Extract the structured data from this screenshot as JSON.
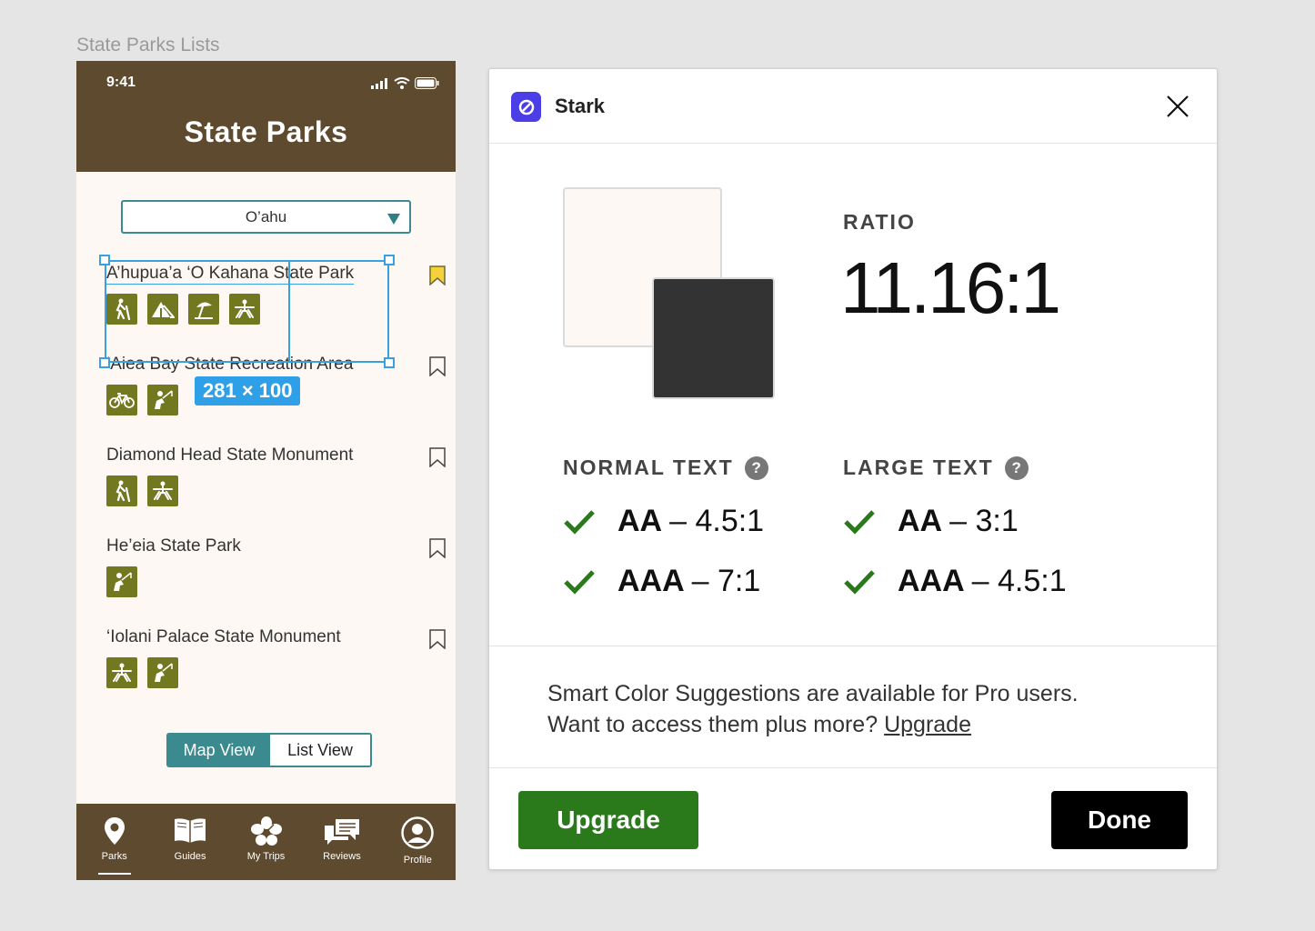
{
  "frame_label": "State Parks Lists",
  "phone": {
    "status_time": "9:41",
    "title": "State Parks",
    "island_select": {
      "value": "O’ahu"
    },
    "parks": [
      {
        "name": "A’hupua’a ‘O Kahana State Park",
        "icons": [
          "hiking-icon",
          "camping-icon",
          "beach-icon",
          "picnic-icon"
        ],
        "bookmarked": true
      },
      {
        "name": "‘Aiea Bay State Recreation Area",
        "icons": [
          "biking-icon",
          "fishing-icon"
        ],
        "bookmarked": false
      },
      {
        "name": "Diamond Head State Monument",
        "icons": [
          "hiking-icon",
          "picnic-icon"
        ],
        "bookmarked": false
      },
      {
        "name": "He’eia State Park",
        "icons": [
          "fishing-icon"
        ],
        "bookmarked": false
      },
      {
        "name": "‘Iolani Palace State Monument",
        "icons": [
          "picnic-icon",
          "fishing-icon"
        ],
        "bookmarked": false
      }
    ],
    "selection_size": "281 × 100",
    "view_toggle": {
      "map": "Map View",
      "list": "List View",
      "selected": "Map View"
    },
    "tabs": [
      {
        "label": "Parks",
        "icon": "map-pin-icon",
        "active": true
      },
      {
        "label": "Guides",
        "icon": "book-icon",
        "active": false
      },
      {
        "label": "My Trips",
        "icon": "hibiscus-icon",
        "active": false
      },
      {
        "label": "Reviews",
        "icon": "chat-icon",
        "active": false
      },
      {
        "label": "Profile",
        "icon": "user-icon",
        "active": false
      }
    ],
    "colors": {
      "header": "#5e4a2f",
      "accent": "#3a8a8f",
      "activity": "#72781f",
      "background": "#fdf8f3"
    }
  },
  "stark": {
    "title": "Stark",
    "ratio_label": "RATIO",
    "ratio_value": "11.16:1",
    "foreground_color": "#fdf8f3",
    "background_color": "#333333",
    "normal_text": {
      "heading": "NORMAL TEXT",
      "help": "?",
      "aa_label": "AA",
      "aa_value": "– 4.5:1",
      "aaa_label": "AAA",
      "aaa_value": "– 7:1"
    },
    "large_text": {
      "heading": "LARGE TEXT",
      "help": "?",
      "aa_label": "AA",
      "aa_value": "– 3:1",
      "aaa_label": "AAA",
      "aaa_value": "– 4.5:1"
    },
    "promo_line1": "Smart Color Suggestions are available for Pro users.",
    "promo_line2": "Want to access them plus more?",
    "promo_link": "Upgrade",
    "upgrade_button": "Upgrade",
    "done_button": "Done",
    "pass_color": "#2a7a1c"
  }
}
